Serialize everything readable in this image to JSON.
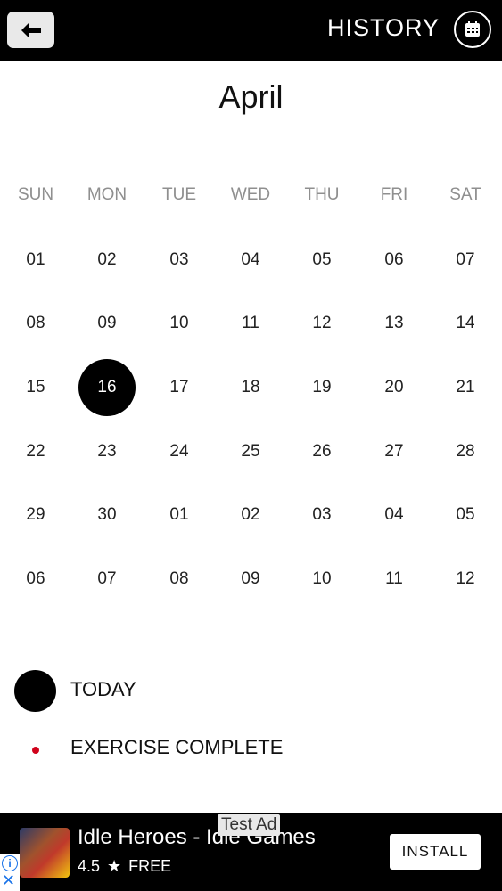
{
  "header": {
    "back_icon": "arrow-left-icon",
    "title": "HISTORY",
    "calendar_icon": "calendar-icon"
  },
  "calendar": {
    "month": "April",
    "weekdays": [
      "SUN",
      "MON",
      "TUE",
      "WED",
      "THU",
      "FRI",
      "SAT"
    ],
    "weeks": [
      [
        "01",
        "02",
        "03",
        "04",
        "05",
        "06",
        "07"
      ],
      [
        "08",
        "09",
        "10",
        "11",
        "12",
        "13",
        "14"
      ],
      [
        "15",
        "16",
        "17",
        "18",
        "19",
        "20",
        "21"
      ],
      [
        "22",
        "23",
        "24",
        "25",
        "26",
        "27",
        "28"
      ],
      [
        "29",
        "30",
        "01",
        "02",
        "03",
        "04",
        "05"
      ],
      [
        "06",
        "07",
        "08",
        "09",
        "10",
        "11",
        "12"
      ]
    ],
    "today": "16"
  },
  "legend": {
    "today_label": "TODAY",
    "exercise_label": "EXERCISE COMPLETE",
    "exercise_color": "#d0021b"
  },
  "ad": {
    "badge": "Test Ad",
    "title": "Idle Heroes - Idle Games",
    "rating": "4.5",
    "price": "FREE",
    "install_label": "INSTALL"
  }
}
